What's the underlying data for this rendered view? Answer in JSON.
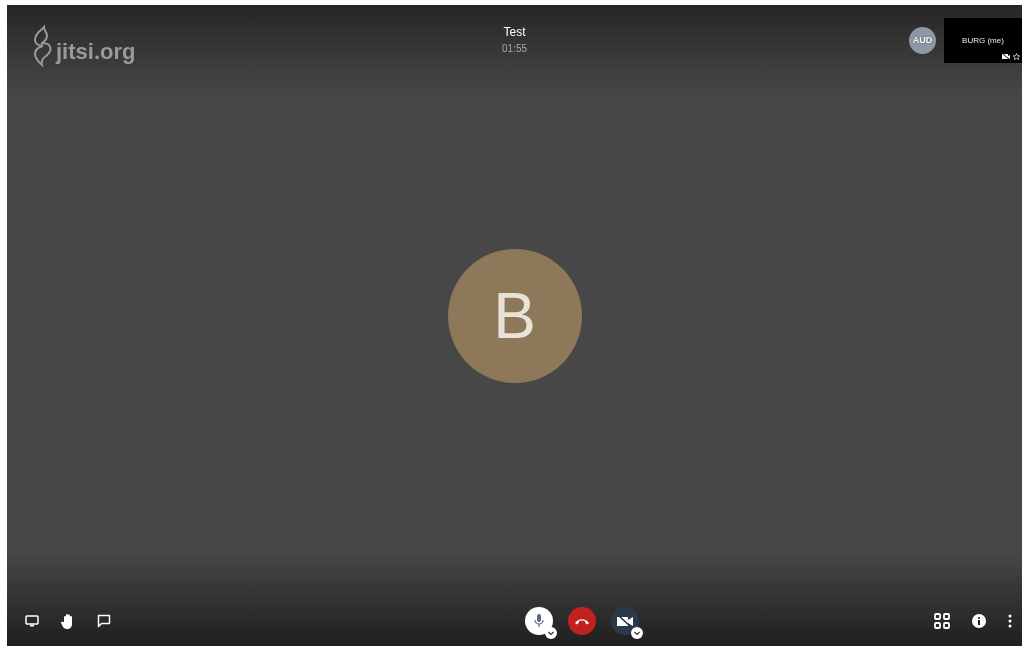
{
  "logo": {
    "text": "jitsi.org"
  },
  "meeting": {
    "title": "Test",
    "timer": "01:55"
  },
  "participants": [
    {
      "initials": "AUD",
      "color": "#8f96a6"
    }
  ],
  "local_thumbnail": {
    "name": "BURG (me)",
    "video_muted": true,
    "dominant": false
  },
  "speaker": {
    "initial": "B",
    "color": "#8d7859"
  },
  "toolbar_left": [
    {
      "kind": "screen"
    },
    {
      "kind": "hand"
    },
    {
      "kind": "chat"
    }
  ],
  "toolbar_center": [
    {
      "kind": "mic",
      "muted": false
    },
    {
      "kind": "hangup"
    },
    {
      "kind": "camera",
      "muted": true
    }
  ],
  "toolbar_right": [
    {
      "kind": "tiles"
    },
    {
      "kind": "info"
    },
    {
      "kind": "more"
    }
  ]
}
